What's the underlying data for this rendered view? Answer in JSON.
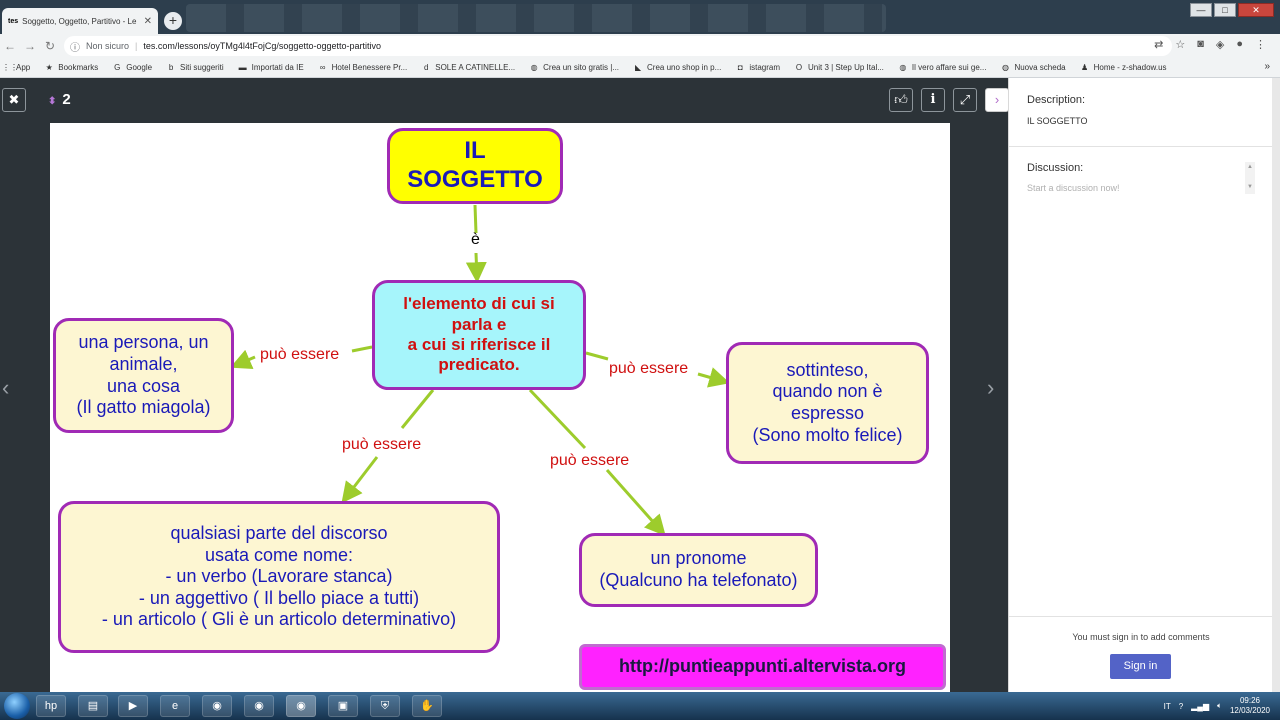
{
  "browser": {
    "tab_title": "Soggetto, Oggetto, Partitivo - Le",
    "tab_favicon": "tes",
    "new_tab": "+",
    "security": "Non sicuro",
    "url": "tes.com/lessons/oyTMg4l4tFojCg/soggetto-oggetto-partitivo",
    "window_controls": {
      "minimize": "—",
      "maximize": "□",
      "close": "✕"
    },
    "bookmarks": [
      {
        "label": "App",
        "icon": "apps-grid-icon"
      },
      {
        "label": "Bookmarks",
        "icon": "star-icon"
      },
      {
        "label": "Google",
        "icon": "google-icon"
      },
      {
        "label": "Siti suggeriti",
        "icon": "bing-icon"
      },
      {
        "label": "Importati da IE",
        "icon": "folder-icon"
      },
      {
        "label": "Hotel Benessere Pr...",
        "icon": "glasses-icon"
      },
      {
        "label": "SOLE A CATINELLE...",
        "icon": "d-icon"
      },
      {
        "label": "Crea un sito gratis |...",
        "icon": "globe-icon"
      },
      {
        "label": "Crea uno shop in p...",
        "icon": "shop-icon"
      },
      {
        "label": "istagram",
        "icon": "instagram-icon"
      },
      {
        "label": "Unit 3 | Step Up Ital...",
        "icon": "o-icon"
      },
      {
        "label": "Il vero affare sui ge...",
        "icon": "globe-icon"
      },
      {
        "label": "Nuova scheda",
        "icon": "globe-icon"
      },
      {
        "label": "Home - z-shadow.us",
        "icon": "user-icon"
      }
    ],
    "bookmarks_more": "»"
  },
  "viewer": {
    "page_number": "2",
    "close_glyph": "✖",
    "page_arrows_glyph": "⬍",
    "prev_glyph": "‹",
    "next_glyph": "›"
  },
  "slide": {
    "title": "IL\nSOGGETTO",
    "connector_e": "è",
    "definition": "l'elemento di cui si\nparla e\na cui si riferisce il\npredicato.",
    "label_persona": "può essere",
    "label_sottinteso": "può essere",
    "label_parte": "può essere",
    "label_pronome": "può essere",
    "box_persona": "una persona, un\nanimale,\nuna cosa\n(Il gatto miagola)",
    "box_sottinteso": "sottinteso,\nquando non è\nespresso\n(Sono molto felice)",
    "box_parte": "qualsiasi parte del discorso\nusata come nome:\n- un verbo (Lavorare stanca)\n- un aggettivo ( Il bello piace a tutti)\n- un articolo ( Gli è un articolo determinativo)",
    "box_pronome": "un pronome\n(Qualcuno ha telefonato)",
    "website": "http://puntieappunti.altervista.org",
    "colors": {
      "title_bg": "#ffff00",
      "title_text": "#1a1ab8",
      "definition_bg": "#a6f5fb",
      "definition_text": "#d01010",
      "box_bg": "#fdf6d2",
      "box_text": "#1a1ab8",
      "border": "#a02ab5",
      "arrow": "#9dcc2c",
      "label_text": "#d01010",
      "website_bg": "#ff22ff"
    }
  },
  "panel": {
    "description_heading": "Description:",
    "description_value": "IL SOGGETTO",
    "discussion_heading": "Discussion:",
    "discussion_placeholder": "Start a discussion now!",
    "sign_in_message": "You must sign in to add comments",
    "sign_in_button": "Sign in"
  },
  "taskbar": {
    "language": "IT",
    "time": "09:26",
    "date": "12/03/2020"
  }
}
